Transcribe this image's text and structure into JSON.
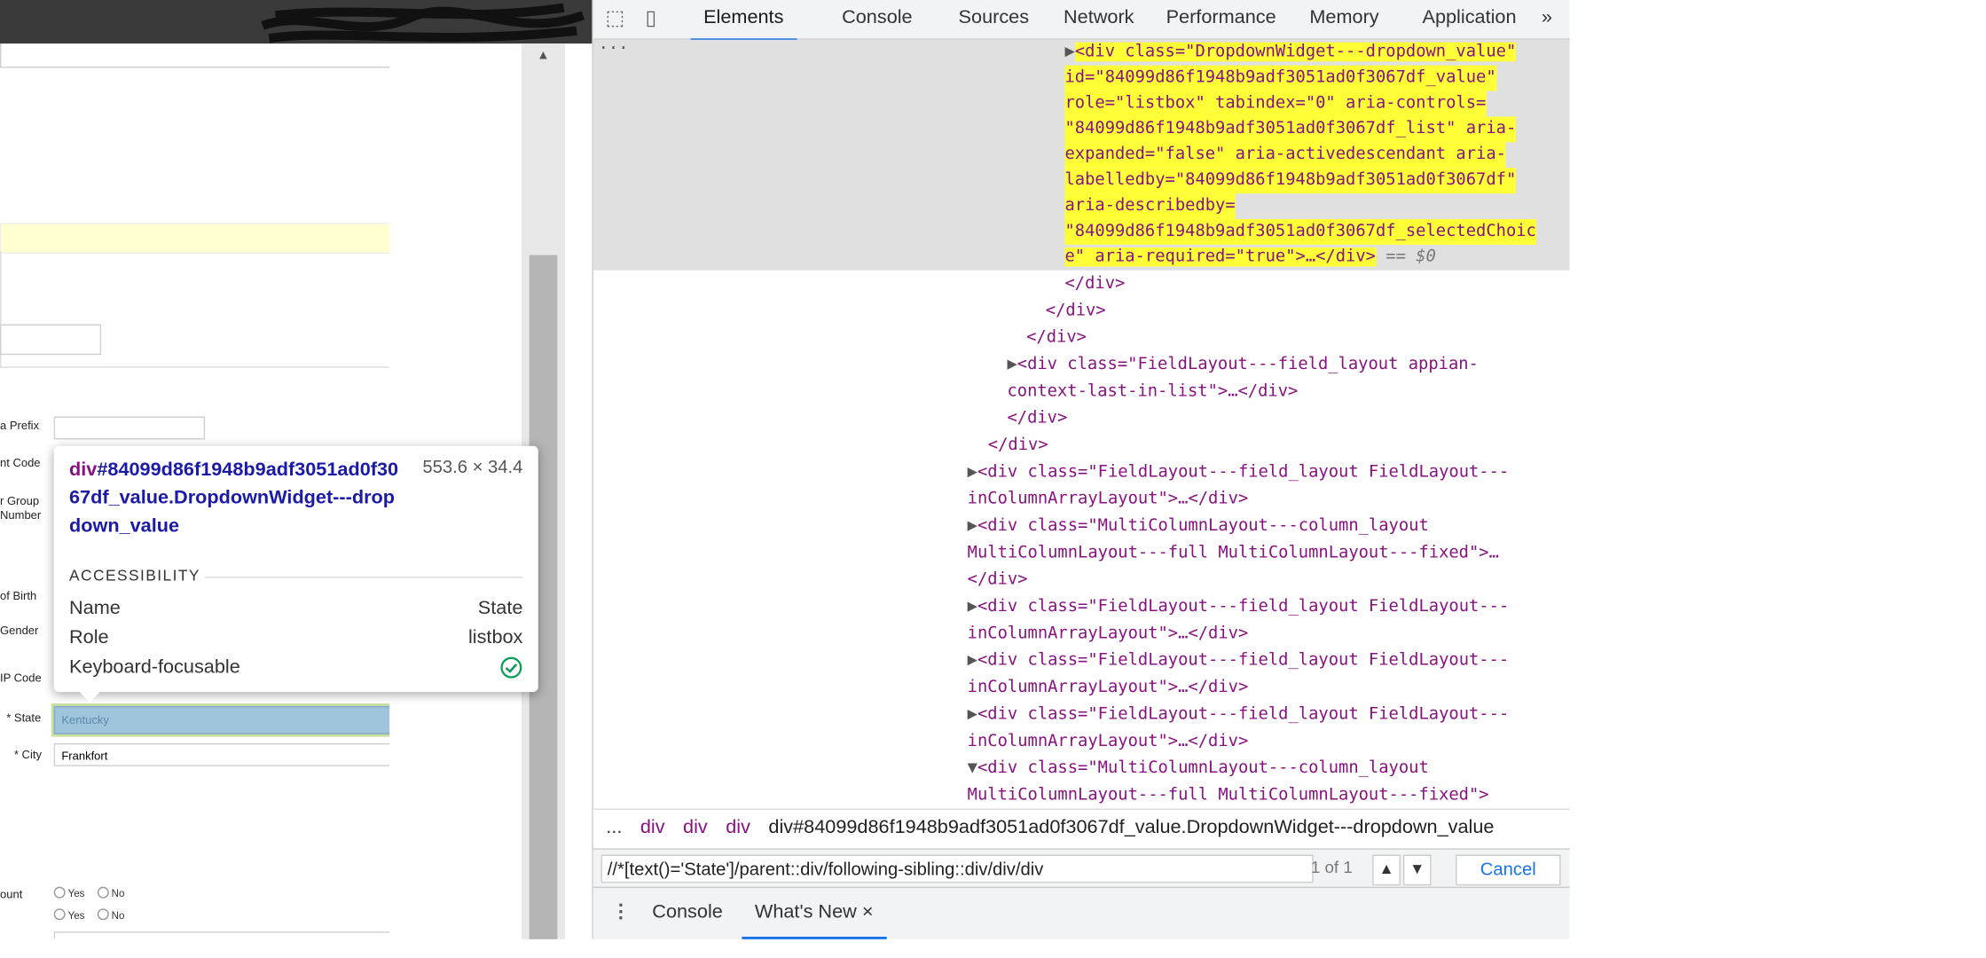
{
  "page": {
    "labels": [
      "a Prefix",
      "nt Code",
      "r Group",
      "Number",
      "of Birth",
      "Gender",
      "IP Code",
      "* State",
      "* City",
      "ount"
    ],
    "state_value": "Kentucky",
    "city_value": "Frankfort",
    "radio_yes": "Yes",
    "radio_no": "No"
  },
  "tooltip": {
    "selector_tag": "div",
    "selector_rest": "#84099d86f1948b9adf3051ad0f3067df_value.DropdownWidget---dropdown_value",
    "dims": "553.6 × 34.4",
    "section": "ACCESSIBILITY",
    "name_label": "Name",
    "name_value": "State",
    "role_label": "Role",
    "role_value": "listbox",
    "focus_label": "Keyboard-focusable"
  },
  "devtools": {
    "tabs": [
      "Elements",
      "Console",
      "Sources",
      "Network",
      "Performance",
      "Memory",
      "Application"
    ],
    "more": "»",
    "ellipsis": "...",
    "code_lines": [
      "<div class=\"DropdownWidget---dropdown_value\"",
      "id=\"84099d86f1948b9adf3051ad0f3067df_value\"",
      "role=\"listbox\" tabindex=\"0\" aria-controls=",
      "\"84099d86f1948b9adf3051ad0f3067df_list\" aria-",
      "expanded=\"false\" aria-activedescendant aria-",
      "labelledby=\"84099d86f1948b9adf3051ad0f3067df\"",
      "aria-describedby=",
      "\"84099d86f1948b9adf3051ad0f3067df_selectedChoic",
      "e\" aria-required=\"true\">…</div>",
      "</div>",
      "</div>",
      "</div>",
      "<div class=\"FieldLayout---field_layout appian-",
      "context-last-in-list\">…</div>",
      "</div>",
      "</div>",
      "<div class=\"FieldLayout---field_layout FieldLayout---",
      "inColumnArrayLayout\">…</div>",
      "<div class=\"MultiColumnLayout---column_layout",
      "MultiColumnLayout---full MultiColumnLayout---fixed\">…",
      "</div>",
      "<div class=\"FieldLayout---field_layout FieldLayout---",
      "inColumnArrayLayout\">…</div>",
      "<div class=\"FieldLayout---field_layout FieldLayout---",
      "inColumnArrayLayout\">…</div>",
      "<div class=\"FieldLayout---field_layout FieldLayout---",
      "inColumnArrayLayout\">…</div>",
      "<div class=\"MultiColumnLayout---column_layout",
      "MultiColumnLayout---full MultiColumnLayout---fixed\">"
    ],
    "eq0": "== $0",
    "breadcrumbs": [
      "...",
      "div",
      "div",
      "div"
    ],
    "breadcrumb_current": "div#84099d86f1948b9adf3051ad0f3067df_value.DropdownWidget---dropdown_value",
    "search_value": "//*[text()='State']/parent::div/following-sibling::div/div/div",
    "match_count": "1 of 1",
    "cancel": "Cancel",
    "drawer_tabs": [
      "Console",
      "What's New"
    ],
    "drawer_close": "×"
  }
}
